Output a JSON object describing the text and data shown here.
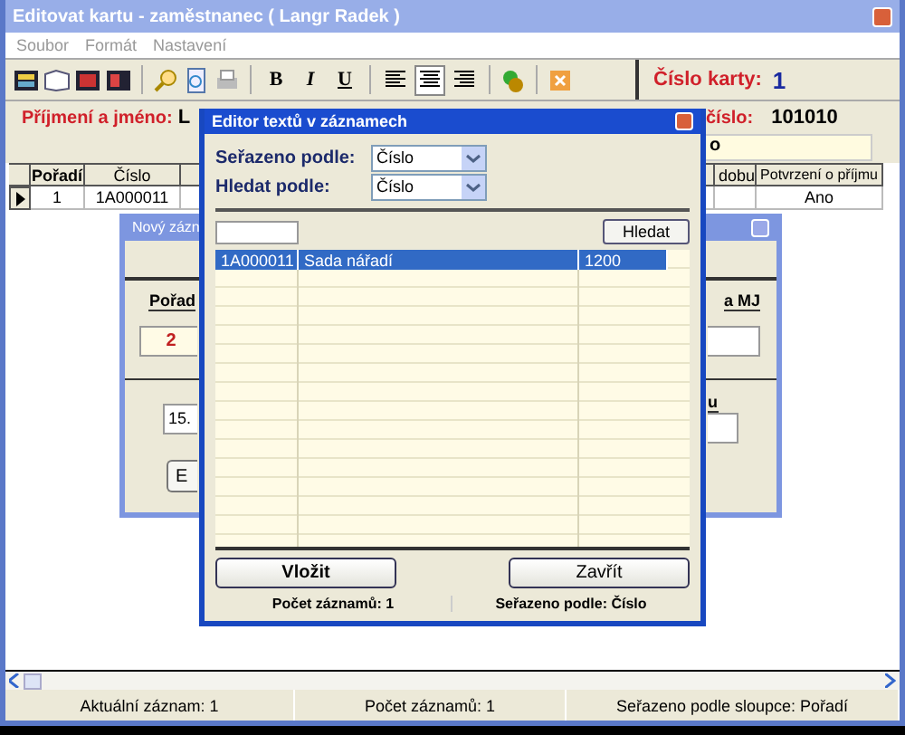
{
  "main_window": {
    "title": "Editovat kartu - zaměstnanec ( Langr Radek )",
    "menu": [
      "Soubor",
      "Formát",
      "Nastavení"
    ],
    "toolbar": {
      "format_buttons": [
        "B",
        "I",
        "U"
      ],
      "align_buttons": [
        {
          "selected": false
        },
        {
          "selected": true
        },
        {
          "selected": false
        }
      ]
    },
    "card_number": {
      "label": "Číslo karty:",
      "value": "1"
    },
    "name": {
      "label": "Příjmení a jméno:",
      "value": "L"
    },
    "personal_number": {
      "label": "číslo:",
      "value": "101010"
    },
    "note_field": {
      "value": "o"
    },
    "grid": {
      "columns": [
        "Pořadí",
        "Číslo",
        "dobu",
        "Potvrzení o příjmu"
      ],
      "rows": [
        {
          "current": true,
          "cells": [
            "1",
            "1A000011",
            "",
            "Ano"
          ]
        }
      ]
    },
    "status_bar": [
      "Aktuální záznam: 1",
      "Počet záznamů: 1",
      "Seřazeno podle sloupce: Pořadí"
    ]
  },
  "record_dialog": {
    "title": "Nový zázn",
    "order_label": "Pořad",
    "order_value": "2",
    "unit_label": "a MJ",
    "date_value": "15.",
    "second_label": "u",
    "button": "E"
  },
  "editor_dialog": {
    "title": "Editor textů v záznamech",
    "sort": {
      "label": "Seřazeno podle:",
      "value": "Číslo"
    },
    "search_by": {
      "label": "Hledat podle:",
      "value": "Číslo"
    },
    "search_button": "Hledat",
    "rows": [
      {
        "selected": true,
        "cells": [
          "1A000011",
          "Sada nářadí",
          "1200"
        ]
      }
    ],
    "buttons": [
      {
        "label": "Vložit",
        "bold": true
      },
      {
        "label": "Zavřít",
        "bold": false
      }
    ],
    "status": [
      "Počet záznamů: 1",
      "Seřazeno podle: Číslo"
    ]
  }
}
